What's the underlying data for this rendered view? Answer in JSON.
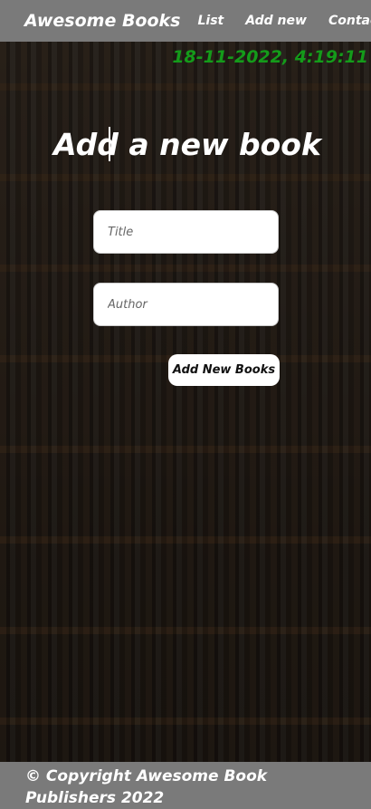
{
  "header": {
    "brand": "Awesome Books",
    "nav": [
      {
        "label": "List"
      },
      {
        "label": "Add new"
      },
      {
        "label": "Contact"
      }
    ]
  },
  "datetime": "18-11-2022, 4:19:11",
  "form": {
    "title": "Add a new book",
    "title_placeholder": "Title",
    "author_placeholder": "Author",
    "submit_label": "Add New Books"
  },
  "footer": {
    "copyright": "© Copyright Awesome Book Publishers 2022"
  },
  "colors": {
    "header_bg": "#7a7a7a",
    "datetime": "#149b1a",
    "text": "#ffffff"
  }
}
